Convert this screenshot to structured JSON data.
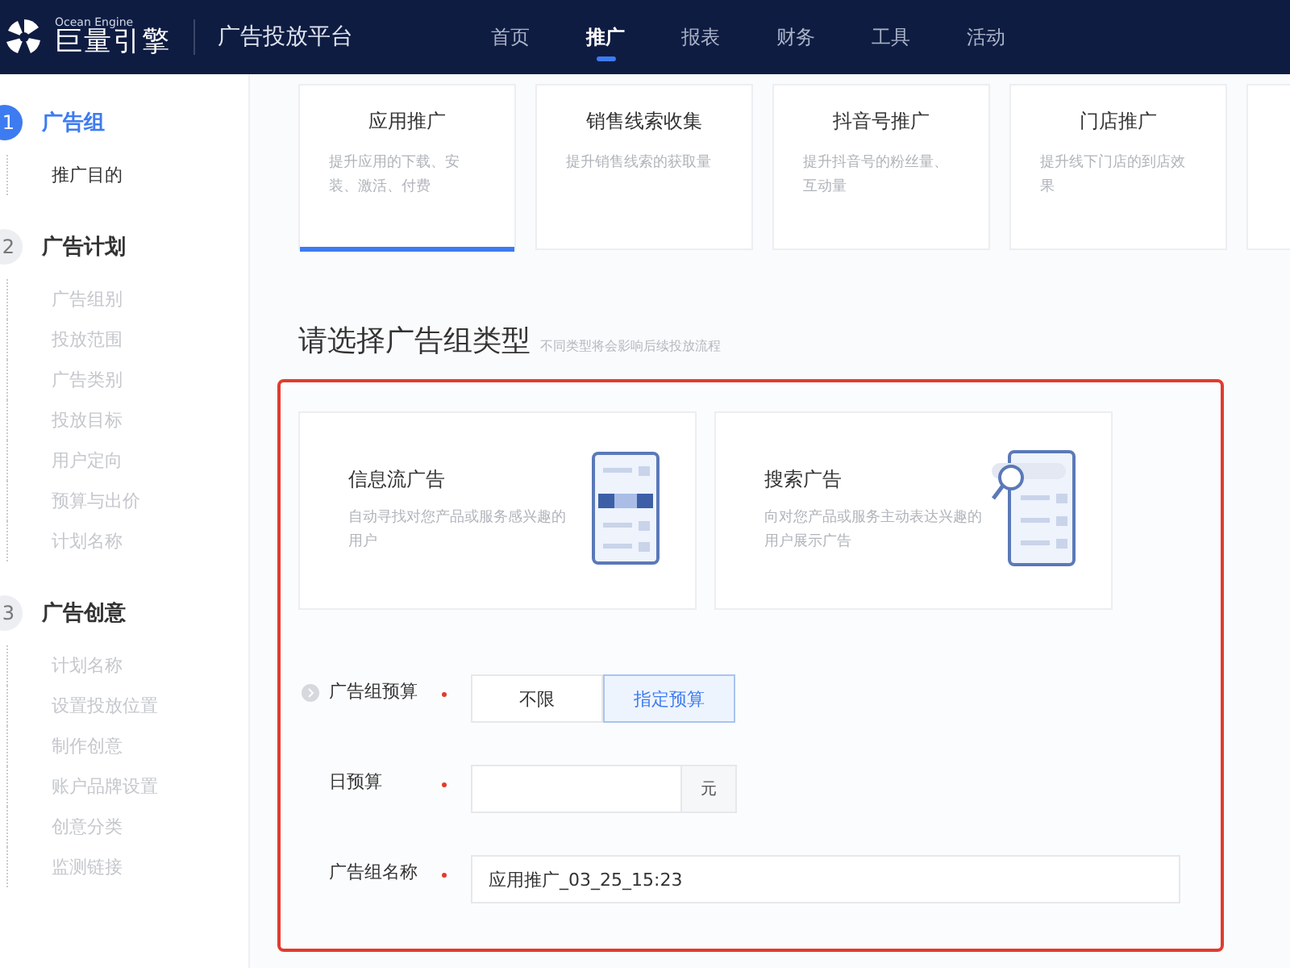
{
  "header": {
    "logo_small": "Ocean Engine",
    "logo": "巨量引擎",
    "platform": "广告投放平台",
    "nav": [
      {
        "label": "首页",
        "selected": false
      },
      {
        "label": "推广",
        "selected": true
      },
      {
        "label": "报表",
        "selected": false
      },
      {
        "label": "财务",
        "selected": false
      },
      {
        "label": "工具",
        "selected": false
      },
      {
        "label": "活动",
        "selected": false
      }
    ]
  },
  "sidebar": {
    "steps": [
      {
        "number": "1",
        "title": "广告组",
        "selected": true,
        "items": [
          {
            "label": "推广目的",
            "disabled": false
          }
        ]
      },
      {
        "number": "2",
        "title": "广告计划",
        "selected": false,
        "items": [
          {
            "label": "广告组别",
            "disabled": true
          },
          {
            "label": "投放范围",
            "disabled": true
          },
          {
            "label": "广告类别",
            "disabled": true
          },
          {
            "label": "投放目标",
            "disabled": true
          },
          {
            "label": "用户定向",
            "disabled": true
          },
          {
            "label": "预算与出价",
            "disabled": true
          },
          {
            "label": "计划名称",
            "disabled": true
          }
        ]
      },
      {
        "number": "3",
        "title": "广告创意",
        "selected": false,
        "items": [
          {
            "label": "计划名称",
            "disabled": true
          },
          {
            "label": "设置投放位置",
            "disabled": true
          },
          {
            "label": "制作创意",
            "disabled": true
          },
          {
            "label": "账户品牌设置",
            "disabled": true
          },
          {
            "label": "创意分类",
            "disabled": true
          },
          {
            "label": "监测链接",
            "disabled": true
          }
        ]
      }
    ]
  },
  "goals": [
    {
      "title": "应用推广",
      "desc": "提升应用的下载、安装、激活、付费",
      "selected": true
    },
    {
      "title": "销售线索收集",
      "desc": "提升销售线索的获取量",
      "selected": false
    },
    {
      "title": "抖音号推广",
      "desc": "提升抖音号的粉丝量、互动量",
      "selected": false
    },
    {
      "title": "门店推广",
      "desc": "提升线下门店的到店效果",
      "selected": false
    }
  ],
  "section": {
    "title": "请选择广告组类型",
    "hint": "不同类型将会影响后续投放流程"
  },
  "ad_types": [
    {
      "kind": "feed",
      "title": "信息流广告",
      "desc": "自动寻找对您产品或服务感兴趣的用户"
    },
    {
      "kind": "search",
      "title": "搜索广告",
      "desc": "向对您产品或服务主动表达兴趣的用户展示广告"
    }
  ],
  "form": [
    {
      "kind": "segmented",
      "label": "广告组预算",
      "required": true,
      "options": [
        {
          "label": "不限",
          "selected": false
        },
        {
          "label": "指定预算",
          "selected": true
        }
      ]
    },
    {
      "kind": "input",
      "label": "日预算",
      "required": true,
      "suffix": "元"
    },
    {
      "kind": "input",
      "label": "广告组名称",
      "required": true,
      "value": "应用推广_03_25_15:23"
    }
  ]
}
